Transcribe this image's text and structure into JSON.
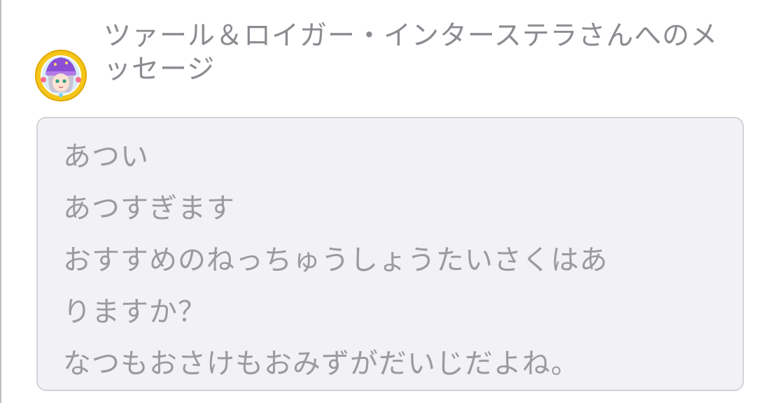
{
  "recipient": {
    "title": "ツァール＆ロイガー・インターステラさんへのメッセージ",
    "avatar_icon": "character-portrait-icon"
  },
  "message": {
    "lines": [
      "あつい",
      "あつすぎます",
      "おすすめのねっちゅうしょうたいさくはあ",
      "りますか？",
      "なつもおさけもおみずがだいじだよね。"
    ]
  },
  "colors": {
    "title_text": "#8b8b91",
    "message_text": "#9a9aa0",
    "box_background": "#f2f2f6",
    "box_border": "#d3d3d8",
    "avatar_ring": "#f5c518",
    "avatar_hat": "#8a4fd6"
  }
}
